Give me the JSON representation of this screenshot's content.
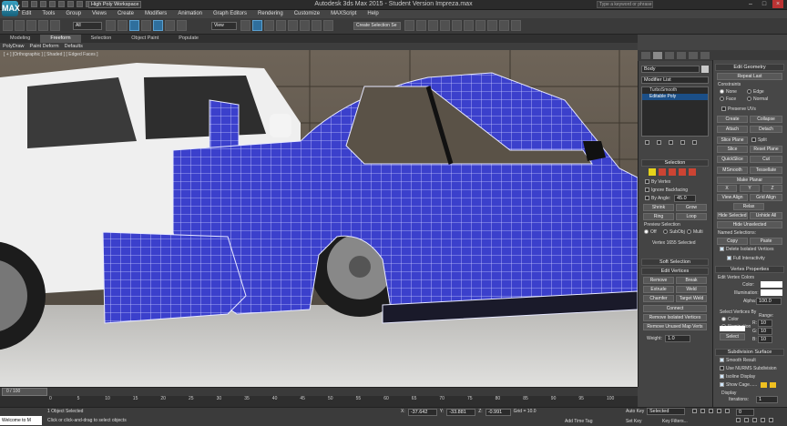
{
  "app": {
    "title": "Autodesk 3ds Max  2015  -  Student Version    Impreza.max",
    "workspace": "High Poly Workspace",
    "search_placeholder": "Type a keyword or phrase",
    "logo": "MAX"
  },
  "menu": [
    "Edit",
    "Tools",
    "Group",
    "Views",
    "Create",
    "Modifiers",
    "Animation",
    "Graph Editors",
    "Rendering",
    "Customize",
    "MAXScript",
    "Help"
  ],
  "toolbar": {
    "filter": "All",
    "ref_coord": "View",
    "sel_set": "Create Selection Se"
  },
  "ribbon": {
    "tabs": [
      "Modeling",
      "Freeform",
      "Selection",
      "Object Paint",
      "Populate"
    ],
    "active": 1,
    "subtabs": [
      "PolyDraw",
      "Paint Deform",
      "Defaults"
    ]
  },
  "viewport": {
    "label": "[ + ] [Orthographic ] [ Shaded ] [ Edged Faces ]"
  },
  "cmd": {
    "object_name": "Body",
    "modifier_list": "Modifier List",
    "stack": [
      "TurboSmooth",
      "Editable Poly"
    ],
    "stack_selected": 1,
    "selection_hdr": "Selection",
    "by_vertex": "By Vertex",
    "ignore_backfacing": "Ignore Backfacing",
    "by_angle": "By Angle:",
    "by_angle_val": "45.0",
    "shrink": "Shrink",
    "grow": "Grow",
    "ring": "Ring",
    "loop": "Loop",
    "preview_sel": "Preview Selection",
    "off": "Off",
    "subobj": "SubObj",
    "multi": "Multi",
    "vert_sel": "Vertex 1655 Selected",
    "soft_sel": "Soft Selection",
    "edit_vertices": "Edit Vertices",
    "remove": "Remove",
    "break": "Break",
    "extrude": "Extrude",
    "weld": "Weld",
    "chamfer": "Chamfer",
    "target_weld": "Target Weld",
    "connect": "Connect",
    "remove_isolated": "Remove Isolated Vertices",
    "remove_unused": "Remove Unused Map Verts",
    "weight": "Weight:",
    "weight_val": "1.0"
  },
  "right": {
    "edit_geometry": "Edit Geometry",
    "repeat_last": "Repeat Last",
    "constraints": "Constraints",
    "none": "None",
    "edge": "Edge",
    "face": "Face",
    "normal": "Normal",
    "preserve_uvs": "Preserve UVs",
    "create": "Create",
    "collapse": "Collapse",
    "attach": "Attach",
    "detach": "Detach",
    "slice_plane": "Slice Plane",
    "split": "Split",
    "slice": "Slice",
    "reset_plane": "Reset Plane",
    "quickslice": "QuickSlice",
    "cut": "Cut",
    "msmooth": "MSmooth",
    "tessellate": "Tessellate",
    "make_planar": "Make Planar",
    "x": "X",
    "y": "Y",
    "z": "Z",
    "view_align": "View Align",
    "grid_align": "Grid Align",
    "relax": "Relax",
    "hide_selected": "Hide Selected",
    "unhide_all": "Unhide All",
    "hide_unselected": "Hide Unselected",
    "named_selections": "Named Selections:",
    "copy": "Copy",
    "paste": "Paste",
    "delete_isolated": "Delete Isolated Vertices",
    "full_interactivity": "Full Interactivity",
    "vertex_props": "Vertex Properties",
    "edit_vertex_colors": "Edit Vertex Colors",
    "color": "Color:",
    "illumination": "Illumination:",
    "alpha": "Alpha:",
    "alpha_val": "100.0",
    "select_by": "Select Vertices By",
    "sb_color": "Color",
    "sb_illum": "Illumination",
    "range": "Range:",
    "r": "R:",
    "g": "G:",
    "b": "B:",
    "range_val": "10",
    "select_btn": "Select",
    "subdiv_surface": "Subdivision Surface",
    "smooth_result": "Smooth Result",
    "use_nurms": "Use NURMS Subdivision",
    "isoline": "Isoline Display",
    "show_cage": "Show Cage......",
    "display": "Display",
    "iterations": "Iterations:",
    "iterations_val": "1"
  },
  "time": {
    "frame": "0 / 100",
    "ticks": [
      "0",
      "5",
      "10",
      "15",
      "20",
      "25",
      "30",
      "35",
      "40",
      "45",
      "50",
      "55",
      "60",
      "65",
      "70",
      "75",
      "80",
      "85",
      "90",
      "95",
      "100"
    ]
  },
  "status": {
    "maxscript": "Welcome to M",
    "objects": "1 Object Selected",
    "prompt": "Click or click-and-drag to select objects",
    "x": "-37.642",
    "y": "-33.881",
    "z": "-0.991",
    "grid": "Grid = 10.0",
    "add_time_tag": "Add Time Tag",
    "auto_key": "Auto Key",
    "set_key": "Set Key",
    "selected": "Selected",
    "key_filters": "Key Filters...",
    "frame_val": "0"
  },
  "colors": {
    "mesh": "#3a3fd0",
    "mesh_line": "#cfd3ff",
    "accent": "#1b4f88"
  }
}
